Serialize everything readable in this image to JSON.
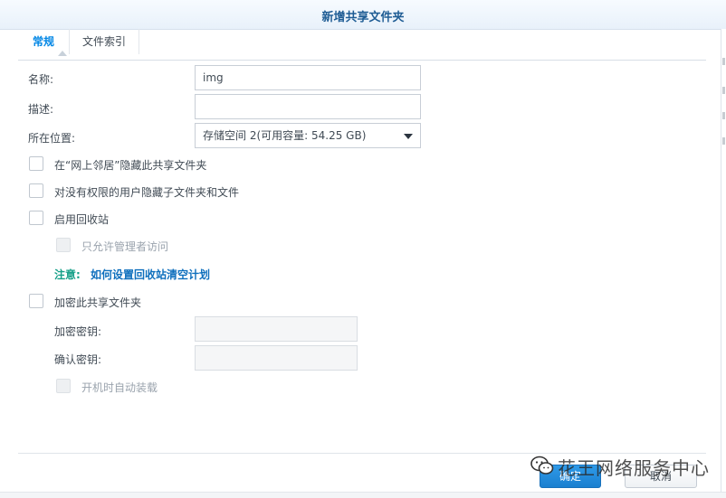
{
  "dialog": {
    "title": "新增共享文件夹"
  },
  "tabs": [
    {
      "label": "常规",
      "active": true
    },
    {
      "label": "文件索引",
      "active": false
    }
  ],
  "form": {
    "name_label": "名称:",
    "name_value": "img",
    "description_label": "描述:",
    "description_value": "",
    "location_label": "所在位置:",
    "location_value": "存储空间 2(可用容量:  54.25 GB)"
  },
  "options": {
    "hide_network": "在“网上邻居”隐藏此共享文件夹",
    "hide_subfolders": "对没有权限的用户隐藏子文件夹和文件",
    "recycle_bin": "启用回收站",
    "admin_only": "只允许管理者访问",
    "note_label": "注意:",
    "note_link": "如何设置回收站清空计划",
    "encrypt": "加密此共享文件夹",
    "encrypt_key_label": "加密密钥:",
    "confirm_key_label": "确认密钥:",
    "auto_mount": "开机时自动装载"
  },
  "buttons": {
    "ok": "确定",
    "cancel": "取消"
  },
  "watermark": {
    "text": "花王网络服务中心"
  },
  "colors": {
    "accent": "#0086e5",
    "link": "#0e6fbd",
    "note": "#17a089",
    "title": "#1e5c94"
  }
}
